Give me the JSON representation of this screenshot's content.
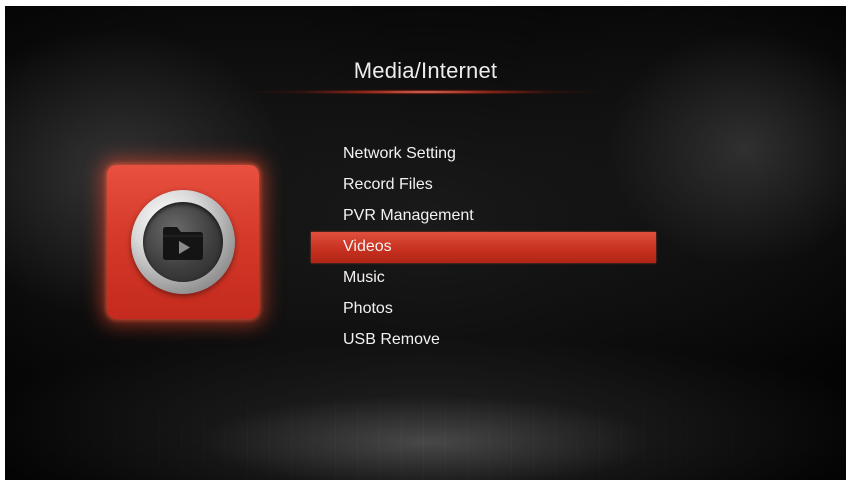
{
  "page": {
    "title": "Media/Internet"
  },
  "category_icon": {
    "icon": "video-folder-icon",
    "tile_color": "#d53a2a"
  },
  "menu": {
    "selected_index": 3,
    "highlight_color": "#c8311f",
    "items": [
      {
        "label": "Network Setting"
      },
      {
        "label": "Record Files"
      },
      {
        "label": "PVR Management"
      },
      {
        "label": "Videos"
      },
      {
        "label": "Music"
      },
      {
        "label": "Photos"
      },
      {
        "label": "USB Remove"
      }
    ]
  }
}
